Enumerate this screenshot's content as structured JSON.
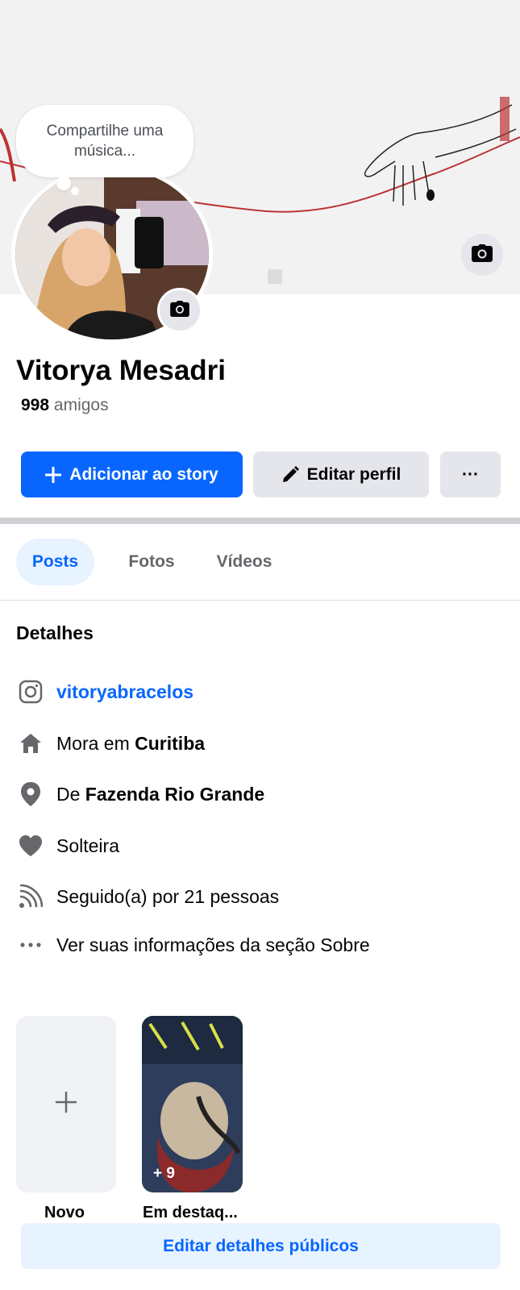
{
  "cover": {
    "camera_icon": "camera-icon"
  },
  "profile": {
    "bubble_text": "Compartilhe uma música...",
    "name": "Vitorya Mesadri",
    "friends_count": "998",
    "friends_label": "amigos"
  },
  "actions": {
    "add_story": "Adicionar ao story",
    "edit_profile": "Editar perfil",
    "more": "···"
  },
  "tabs": [
    {
      "label": "Posts",
      "active": true
    },
    {
      "label": "Fotos",
      "active": false
    },
    {
      "label": "Vídeos",
      "active": false
    }
  ],
  "details": {
    "title": "Detalhes",
    "instagram": "vitoryabracelos",
    "lives_prefix": "Mora em ",
    "lives_city": "Curitiba",
    "from_prefix": "De ",
    "from_city": "Fazenda Rio Grande",
    "relationship": "Solteira",
    "followers": "Seguido(a) por 21 pessoas",
    "see_about": "Ver suas informações da seção Sobre"
  },
  "featured": {
    "new_label": "Novo",
    "highlight_label": "Em destaq...",
    "highlight_count": "+ 9"
  },
  "edit_public": "Editar detalhes públicos",
  "colors": {
    "accent": "#0866ff",
    "accent_light": "#e7f3ff",
    "button_gray": "#e4e6eb"
  }
}
